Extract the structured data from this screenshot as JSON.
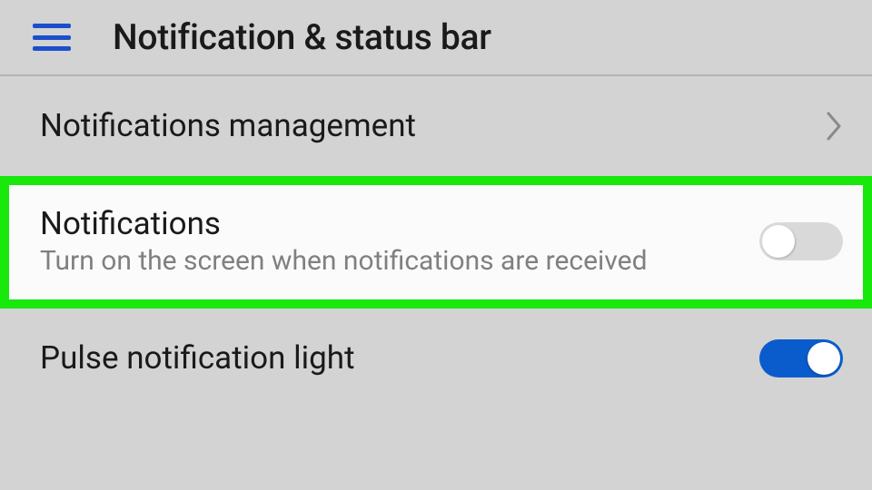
{
  "header": {
    "title": "Notification & status bar"
  },
  "rows": {
    "management": {
      "label": "Notifications management"
    },
    "notifications": {
      "title": "Notifications",
      "subtitle": "Turn on the screen when notifications are received",
      "toggle": "off"
    },
    "pulse": {
      "label": "Pulse notification light",
      "toggle": "on"
    }
  },
  "colors": {
    "accent": "#0a5ccc",
    "hamburger": "#1a4fcc",
    "highlight_border": "#18e80b"
  }
}
